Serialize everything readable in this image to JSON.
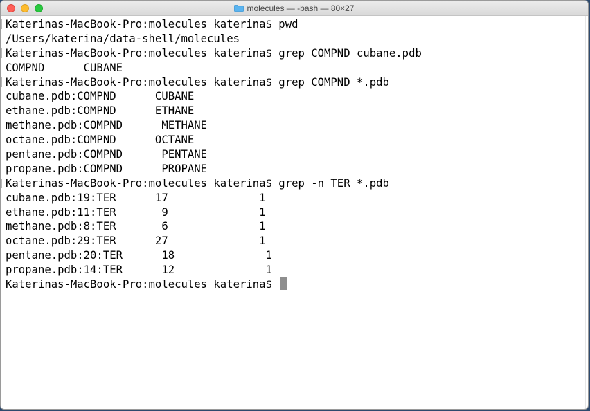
{
  "window": {
    "title": "molecules — -bash — 80×27",
    "folder_icon": "folder-icon",
    "accent_folder_color": "#5ab4f0"
  },
  "terminal": {
    "lines": [
      {
        "text": "Katerinas-MacBook-Pro:molecules katerina$ pwd",
        "prompt": true
      },
      {
        "text": "/Users/katerina/data-shell/molecules",
        "prompt": false
      },
      {
        "text": "Katerinas-MacBook-Pro:molecules katerina$ grep COMPND cubane.pdb",
        "prompt": true
      },
      {
        "text": "COMPND      CUBANE",
        "prompt": false
      },
      {
        "text": "Katerinas-MacBook-Pro:molecules katerina$ grep COMPND *.pdb",
        "prompt": true
      },
      {
        "text": "cubane.pdb:COMPND      CUBANE",
        "prompt": false
      },
      {
        "text": "ethane.pdb:COMPND      ETHANE",
        "prompt": false
      },
      {
        "text": "methane.pdb:COMPND      METHANE",
        "prompt": false
      },
      {
        "text": "octane.pdb:COMPND      OCTANE",
        "prompt": false
      },
      {
        "text": "pentane.pdb:COMPND      PENTANE",
        "prompt": false
      },
      {
        "text": "propane.pdb:COMPND      PROPANE",
        "prompt": false
      },
      {
        "text": "Katerinas-MacBook-Pro:molecules katerina$ grep -n TER *.pdb",
        "prompt": true
      },
      {
        "text": "cubane.pdb:19:TER      17              1",
        "prompt": false
      },
      {
        "text": "ethane.pdb:11:TER       9              1",
        "prompt": false
      },
      {
        "text": "methane.pdb:8:TER       6              1",
        "prompt": false
      },
      {
        "text": "octane.pdb:29:TER      27              1",
        "prompt": false
      },
      {
        "text": "pentane.pdb:20:TER      18              1",
        "prompt": false
      },
      {
        "text": "propane.pdb:14:TER      12              1",
        "prompt": false
      },
      {
        "text": "Katerinas-MacBook-Pro:molecules katerina$ ",
        "prompt": false,
        "cursor": true
      }
    ],
    "cursor_color": "#8e8e8e"
  }
}
